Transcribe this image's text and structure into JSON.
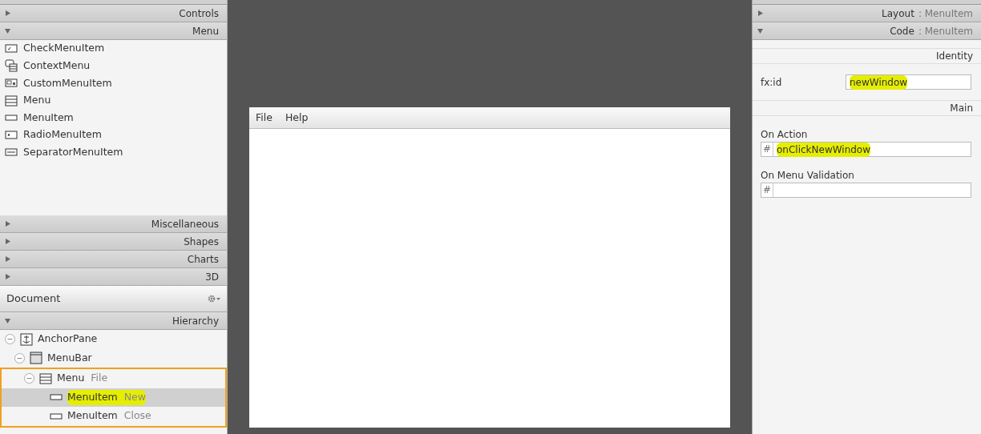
{
  "library": {
    "sections_top": [
      {
        "label": "Controls",
        "expanded": false
      },
      {
        "label": "Menu",
        "expanded": true
      }
    ],
    "items": [
      {
        "label": "CheckMenuItem",
        "kind": "check"
      },
      {
        "label": "ContextMenu",
        "kind": "context"
      },
      {
        "label": "CustomMenuItem",
        "kind": "custom"
      },
      {
        "label": "Menu",
        "kind": "menu"
      },
      {
        "label": "MenuItem",
        "kind": "item"
      },
      {
        "label": "RadioMenuItem",
        "kind": "radio"
      },
      {
        "label": "SeparatorMenuItem",
        "kind": "separator"
      }
    ],
    "sections_bottom": [
      {
        "label": "Miscellaneous",
        "expanded": false
      },
      {
        "label": "Shapes",
        "expanded": false
      },
      {
        "label": "Charts",
        "expanded": false
      },
      {
        "label": "3D",
        "expanded": false
      }
    ]
  },
  "document": {
    "title": "Document",
    "section": {
      "label": "Hierarchy",
      "expanded": true
    },
    "tree": [
      {
        "type": "AnchorPane",
        "kind": "anchor",
        "expanded": true,
        "selected": false,
        "children": [
          {
            "type": "MenuBar",
            "kind": "menubar",
            "expanded": true,
            "selected": false,
            "children": [
              {
                "type": "Menu",
                "text": "File",
                "kind": "menu",
                "expanded": true,
                "selected": false,
                "outlined": true,
                "children": [
                  {
                    "type": "MenuItem",
                    "text": "New",
                    "kind": "item",
                    "selected": true,
                    "highlighted": true
                  },
                  {
                    "type": "MenuItem",
                    "text": "Close",
                    "kind": "item",
                    "selected": false,
                    "highlighted": false
                  }
                ]
              }
            ]
          }
        ]
      }
    ]
  },
  "preview": {
    "menus": [
      "File",
      "Help"
    ]
  },
  "inspector": {
    "sections": [
      {
        "label": "Layout",
        "target": ": MenuItem",
        "expanded": false
      },
      {
        "label": "Code",
        "target": ": MenuItem",
        "expanded": true
      }
    ],
    "identity": {
      "heading": "Identity",
      "label": "fx:id",
      "value": "newWindow",
      "highlighted": true
    },
    "main": {
      "heading": "Main",
      "fields": [
        {
          "label": "On Action",
          "prefix": "#",
          "value": "onClickNewWindow",
          "highlighted": true
        },
        {
          "label": "On Menu Validation",
          "prefix": "#",
          "highlighted": false
        }
      ]
    }
  }
}
